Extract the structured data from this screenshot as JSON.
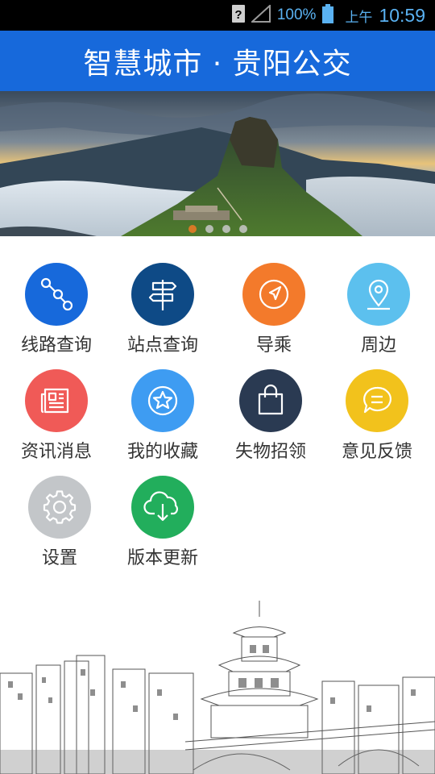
{
  "status_bar": {
    "battery": "100%",
    "ampm": "上午",
    "time": "10:59",
    "icons": [
      "unknown-sim-icon",
      "signal-icon",
      "battery-icon"
    ]
  },
  "header": {
    "title": "智慧城市 · 贵阳公交"
  },
  "banner": {
    "slide_count": 4,
    "active_index": 0
  },
  "menu": {
    "items": [
      {
        "label": "线路查询",
        "icon": "route-icon",
        "color": "#1769db"
      },
      {
        "label": "站点查询",
        "icon": "signpost-icon",
        "color": "#0e4a86"
      },
      {
        "label": "导乘",
        "icon": "navigation-icon",
        "color": "#f37a2b"
      },
      {
        "label": "周边",
        "icon": "location-pin-icon",
        "color": "#5cc0ee"
      },
      {
        "label": "资讯消息",
        "icon": "newspaper-icon",
        "color": "#f05a57"
      },
      {
        "label": "我的收藏",
        "icon": "star-icon",
        "color": "#3e9cf2"
      },
      {
        "label": "失物招领",
        "icon": "bag-icon",
        "color": "#2a3a52"
      },
      {
        "label": "意见反馈",
        "icon": "chat-icon",
        "color": "#f2c21c"
      },
      {
        "label": "设置",
        "icon": "gear-icon",
        "color": "#c3c6c9"
      },
      {
        "label": "版本更新",
        "icon": "cloud-download-icon",
        "color": "#22ae5c"
      }
    ]
  }
}
